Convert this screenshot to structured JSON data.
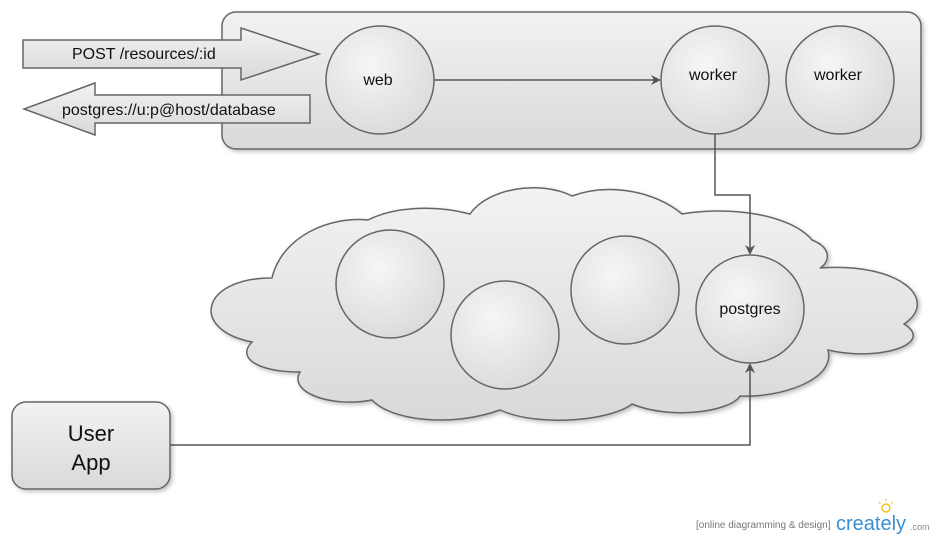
{
  "arrows": {
    "request_label": "POST /resources/:id",
    "db_url_label": "postgres://u:p@host/database"
  },
  "nodes": {
    "web": "web",
    "worker_1": "worker",
    "worker_2": "worker",
    "postgres": "postgres"
  },
  "user_app": {
    "line1": "User",
    "line2": "App"
  },
  "branding": {
    "tagline": "[online diagramming & design]",
    "logo_text": "creately",
    "logo_suffix": ".com"
  },
  "colors": {
    "shape_fill": "#e6e6e6",
    "stroke": "#555555",
    "connector": "#555555",
    "logo_blue": "#3b8fd0"
  }
}
